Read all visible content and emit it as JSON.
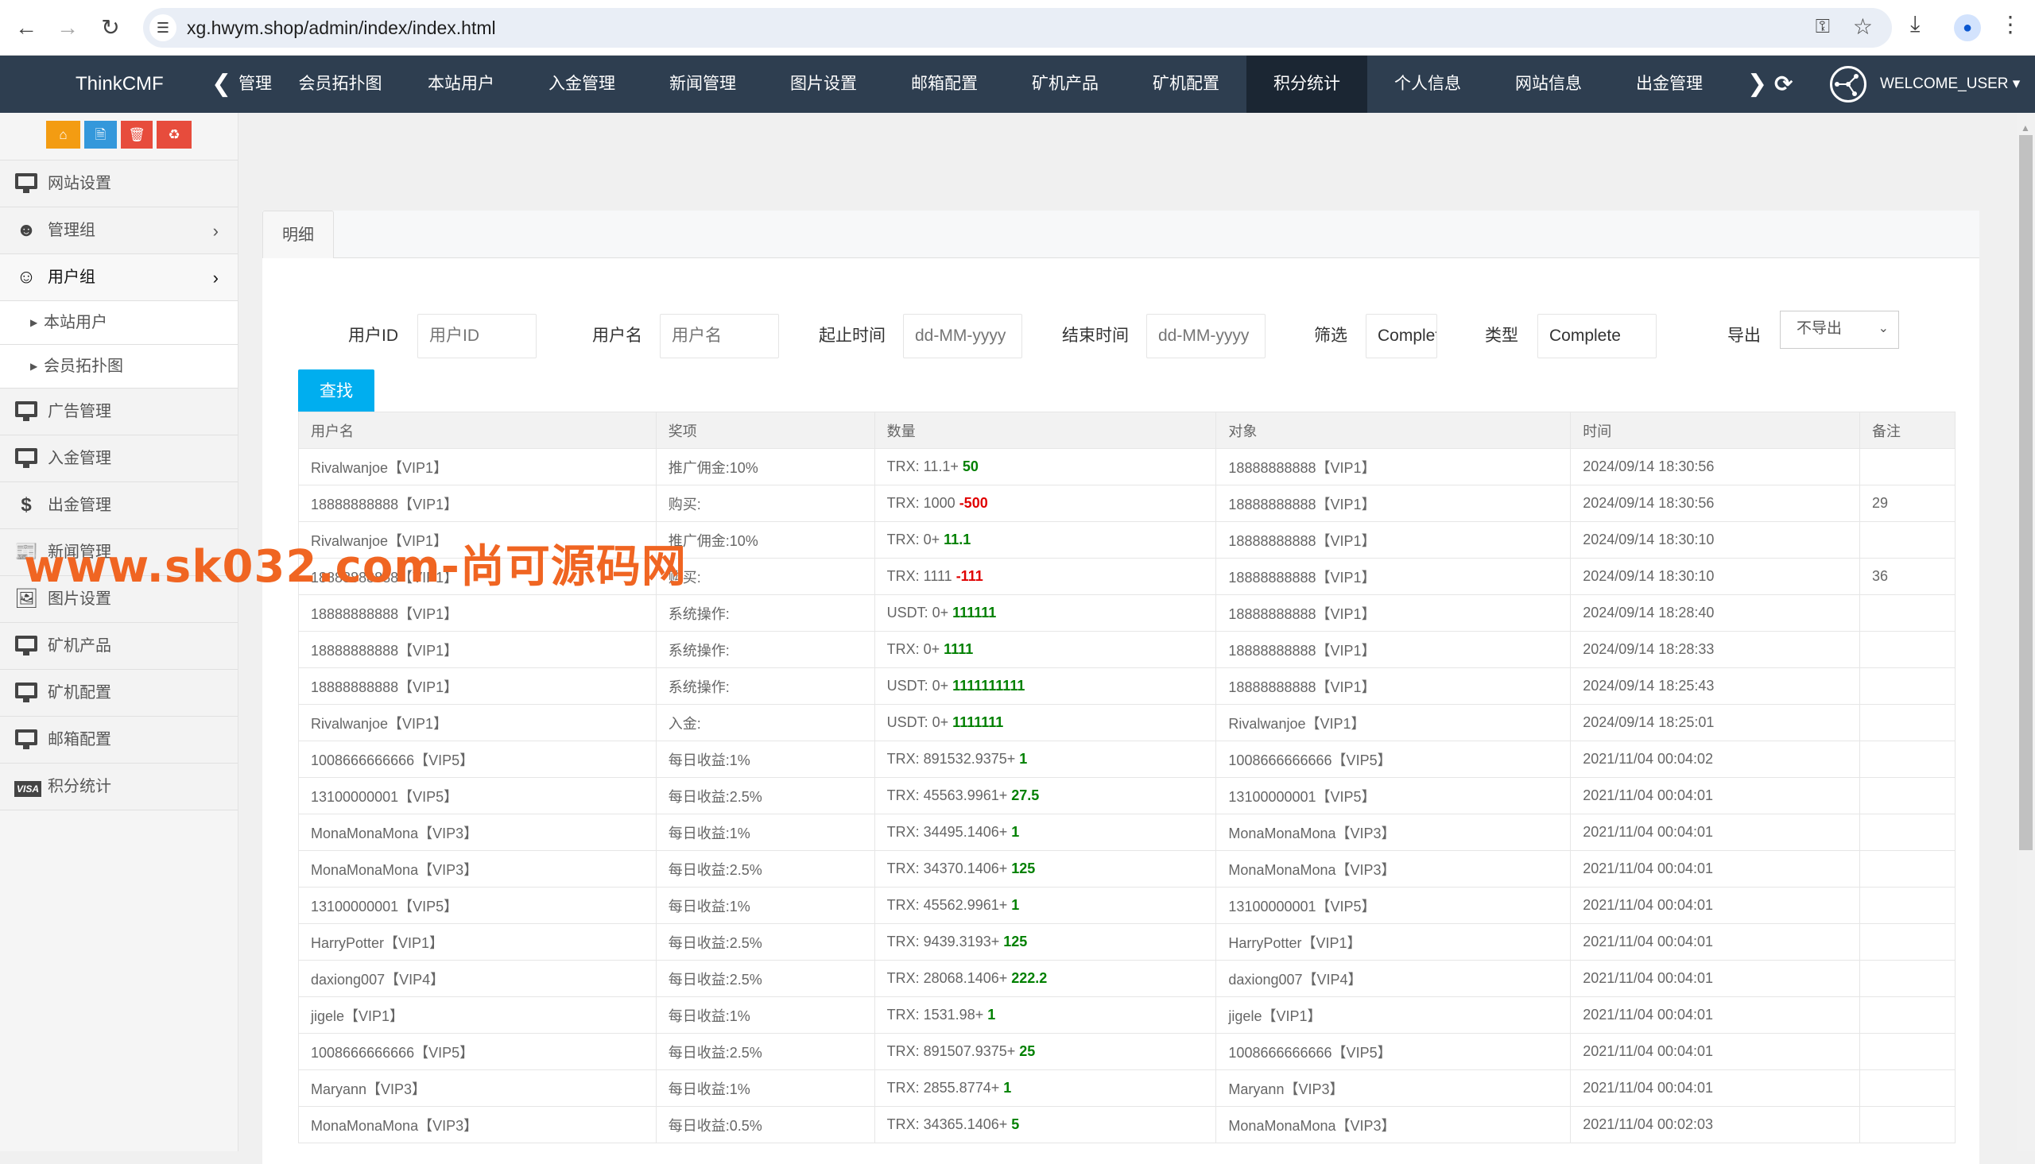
{
  "browser": {
    "url": "xg.hwym.shop/admin/index/index.html",
    "icons": [
      "back-icon",
      "forward-icon",
      "reload-icon",
      "site-info-icon",
      "password-key-icon",
      "bookmark-star-icon",
      "download-icon",
      "profile-icon",
      "more-menu-icon"
    ]
  },
  "topnav": {
    "brand": "ThinkCMF",
    "tabs": [
      {
        "label": "管理",
        "active": false
      },
      {
        "label": "会员拓扑图",
        "active": false
      },
      {
        "label": "本站用户",
        "active": false
      },
      {
        "label": "入金管理",
        "active": false
      },
      {
        "label": "新闻管理",
        "active": false
      },
      {
        "label": "图片设置",
        "active": false
      },
      {
        "label": "邮箱配置",
        "active": false
      },
      {
        "label": "矿机产品",
        "active": false
      },
      {
        "label": "矿机配置",
        "active": false
      },
      {
        "label": "积分统计",
        "active": true
      },
      {
        "label": "个人信息",
        "active": false
      },
      {
        "label": "网站信息",
        "active": false
      },
      {
        "label": "出金管理",
        "active": false
      }
    ],
    "user": "WELCOME_USER"
  },
  "sidebar": {
    "quick_buttons": [
      {
        "icon": "home-icon",
        "color": "#f39c12"
      },
      {
        "icon": "file-icon",
        "color": "#3498db"
      },
      {
        "icon": "trash-icon",
        "color": "#e74c3c"
      },
      {
        "icon": "recycle-icon",
        "color": "#e74c3c"
      }
    ],
    "items": [
      {
        "label": "网站设置",
        "icon": "monitor-icon"
      },
      {
        "label": "管理组",
        "icon": "user-circle-icon"
      },
      {
        "label": "用户组",
        "icon": "user-circle-icon"
      },
      {
        "label": "本站用户"
      },
      {
        "label": "会员拓扑图"
      },
      {
        "label": "广告管理",
        "icon": "monitor-icon"
      },
      {
        "label": "入金管理",
        "icon": "monitor-icon"
      },
      {
        "label": "出金管理",
        "icon": "dollar-icon"
      },
      {
        "label": "新闻管理",
        "icon": "newspaper-icon"
      },
      {
        "label": "图片设置",
        "icon": "image-file-icon"
      },
      {
        "label": "矿机产品",
        "icon": "monitor-icon"
      },
      {
        "label": "矿机配置",
        "icon": "monitor-icon"
      },
      {
        "label": "邮箱配置",
        "icon": "monitor-icon"
      },
      {
        "label": "积分统计",
        "icon": "visa-card-icon"
      }
    ],
    "visa_text": "VISA"
  },
  "panel": {
    "tab": "明细",
    "filters": {
      "user_id_label": "用户ID",
      "user_id_placeholder": "用户ID",
      "username_label": "用户名",
      "username_placeholder": "用户名",
      "start_label": "起止时间",
      "start_placeholder": "dd-MM-yyyy",
      "end_label": "结束时间",
      "end_placeholder": "dd-MM-yyyy",
      "filter_label": "筛选",
      "filter_value": "Complete",
      "type_label": "类型",
      "type_value": "Complete",
      "export_label": "导出",
      "export_value": "不导出"
    },
    "search_button": "查找"
  },
  "table": {
    "headers": [
      "用户名",
      "奖项",
      "数量",
      "对象",
      "时间",
      "备注"
    ],
    "rows": [
      {
        "user": "Rivalwanjoe【VIP1】",
        "item": "推广佣金:10%",
        "amount_prefix": "TRX: 11.1+ ",
        "delta": "50",
        "sign": "pos",
        "target": "18888888888【VIP1】",
        "time": "2024/09/14 18:30:56",
        "note": ""
      },
      {
        "user": "18888888888【VIP1】",
        "item": "购买:",
        "amount_prefix": "TRX: 1000 ",
        "delta": "-500",
        "sign": "neg",
        "target": "18888888888【VIP1】",
        "time": "2024/09/14 18:30:56",
        "note": "29"
      },
      {
        "user": "Rivalwanjoe【VIP1】",
        "item": "推广佣金:10%",
        "amount_prefix": "TRX: 0+ ",
        "delta": "11.1",
        "sign": "pos",
        "target": "18888888888【VIP1】",
        "time": "2024/09/14 18:30:10",
        "note": ""
      },
      {
        "user": "18888888888【VIP1】",
        "item": "购买:",
        "amount_prefix": "TRX: 1111 ",
        "delta": "-111",
        "sign": "neg",
        "target": "18888888888【VIP1】",
        "time": "2024/09/14 18:30:10",
        "note": "36"
      },
      {
        "user": "18888888888【VIP1】",
        "item": "系统操作:",
        "amount_prefix": "USDT: 0+ ",
        "delta": "111111",
        "sign": "pos",
        "target": "18888888888【VIP1】",
        "time": "2024/09/14 18:28:40",
        "note": ""
      },
      {
        "user": "18888888888【VIP1】",
        "item": "系统操作:",
        "amount_prefix": "TRX: 0+ ",
        "delta": "1111",
        "sign": "pos",
        "target": "18888888888【VIP1】",
        "time": "2024/09/14 18:28:33",
        "note": ""
      },
      {
        "user": "18888888888【VIP1】",
        "item": "系统操作:",
        "amount_prefix": "USDT: 0+ ",
        "delta": "1111111111",
        "sign": "pos",
        "target": "18888888888【VIP1】",
        "time": "2024/09/14 18:25:43",
        "note": ""
      },
      {
        "user": "Rivalwanjoe【VIP1】",
        "item": "入金:",
        "amount_prefix": "USDT: 0+ ",
        "delta": "1111111",
        "sign": "pos",
        "target": "Rivalwanjoe【VIP1】",
        "time": "2024/09/14 18:25:01",
        "note": ""
      },
      {
        "user": "1008666666666【VIP5】",
        "item": "每日收益:1%",
        "amount_prefix": "TRX: 891532.9375+ ",
        "delta": "1",
        "sign": "pos",
        "target": "1008666666666【VIP5】",
        "time": "2021/11/04 00:04:02",
        "note": ""
      },
      {
        "user": "13100000001【VIP5】",
        "item": "每日收益:2.5%",
        "amount_prefix": "TRX: 45563.9961+ ",
        "delta": "27.5",
        "sign": "pos",
        "target": "13100000001【VIP5】",
        "time": "2021/11/04 00:04:01",
        "note": ""
      },
      {
        "user": "MonaMonaMona【VIP3】",
        "item": "每日收益:1%",
        "amount_prefix": "TRX: 34495.1406+ ",
        "delta": "1",
        "sign": "pos",
        "target": "MonaMonaMona【VIP3】",
        "time": "2021/11/04 00:04:01",
        "note": ""
      },
      {
        "user": "MonaMonaMona【VIP3】",
        "item": "每日收益:2.5%",
        "amount_prefix": "TRX: 34370.1406+ ",
        "delta": "125",
        "sign": "pos",
        "target": "MonaMonaMona【VIP3】",
        "time": "2021/11/04 00:04:01",
        "note": ""
      },
      {
        "user": "13100000001【VIP5】",
        "item": "每日收益:1%",
        "amount_prefix": "TRX: 45562.9961+ ",
        "delta": "1",
        "sign": "pos",
        "target": "13100000001【VIP5】",
        "time": "2021/11/04 00:04:01",
        "note": ""
      },
      {
        "user": "HarryPotter【VIP1】",
        "item": "每日收益:2.5%",
        "amount_prefix": "TRX: 9439.3193+ ",
        "delta": "125",
        "sign": "pos",
        "target": "HarryPotter【VIP1】",
        "time": "2021/11/04 00:04:01",
        "note": ""
      },
      {
        "user": "daxiong007【VIP4】",
        "item": "每日收益:2.5%",
        "amount_prefix": "TRX: 28068.1406+ ",
        "delta": "222.2",
        "sign": "pos",
        "target": "daxiong007【VIP4】",
        "time": "2021/11/04 00:04:01",
        "note": ""
      },
      {
        "user": "jigele【VIP1】",
        "item": "每日收益:1%",
        "amount_prefix": "TRX: 1531.98+ ",
        "delta": "1",
        "sign": "pos",
        "target": "jigele【VIP1】",
        "time": "2021/11/04 00:04:01",
        "note": ""
      },
      {
        "user": "1008666666666【VIP5】",
        "item": "每日收益:2.5%",
        "amount_prefix": "TRX: 891507.9375+ ",
        "delta": "25",
        "sign": "pos",
        "target": "1008666666666【VIP5】",
        "time": "2021/11/04 00:04:01",
        "note": ""
      },
      {
        "user": "Maryann【VIP3】",
        "item": "每日收益:1%",
        "amount_prefix": "TRX: 2855.8774+ ",
        "delta": "1",
        "sign": "pos",
        "target": "Maryann【VIP3】",
        "time": "2021/11/04 00:04:01",
        "note": ""
      },
      {
        "user": "MonaMonaMona【VIP3】",
        "item": "每日收益:0.5%",
        "amount_prefix": "TRX: 34365.1406+ ",
        "delta": "5",
        "sign": "pos",
        "target": "MonaMonaMona【VIP3】",
        "time": "2021/11/04 00:02:03",
        "note": ""
      }
    ]
  },
  "colors": {
    "nav_bg": "#2e3e50",
    "nav_active": "#1b2633",
    "search_button": "#00aeef",
    "positive": "#008000",
    "negative": "#e00000",
    "watermark": "#f06522"
  },
  "watermark": "www.sk032.com-尚可源码网"
}
